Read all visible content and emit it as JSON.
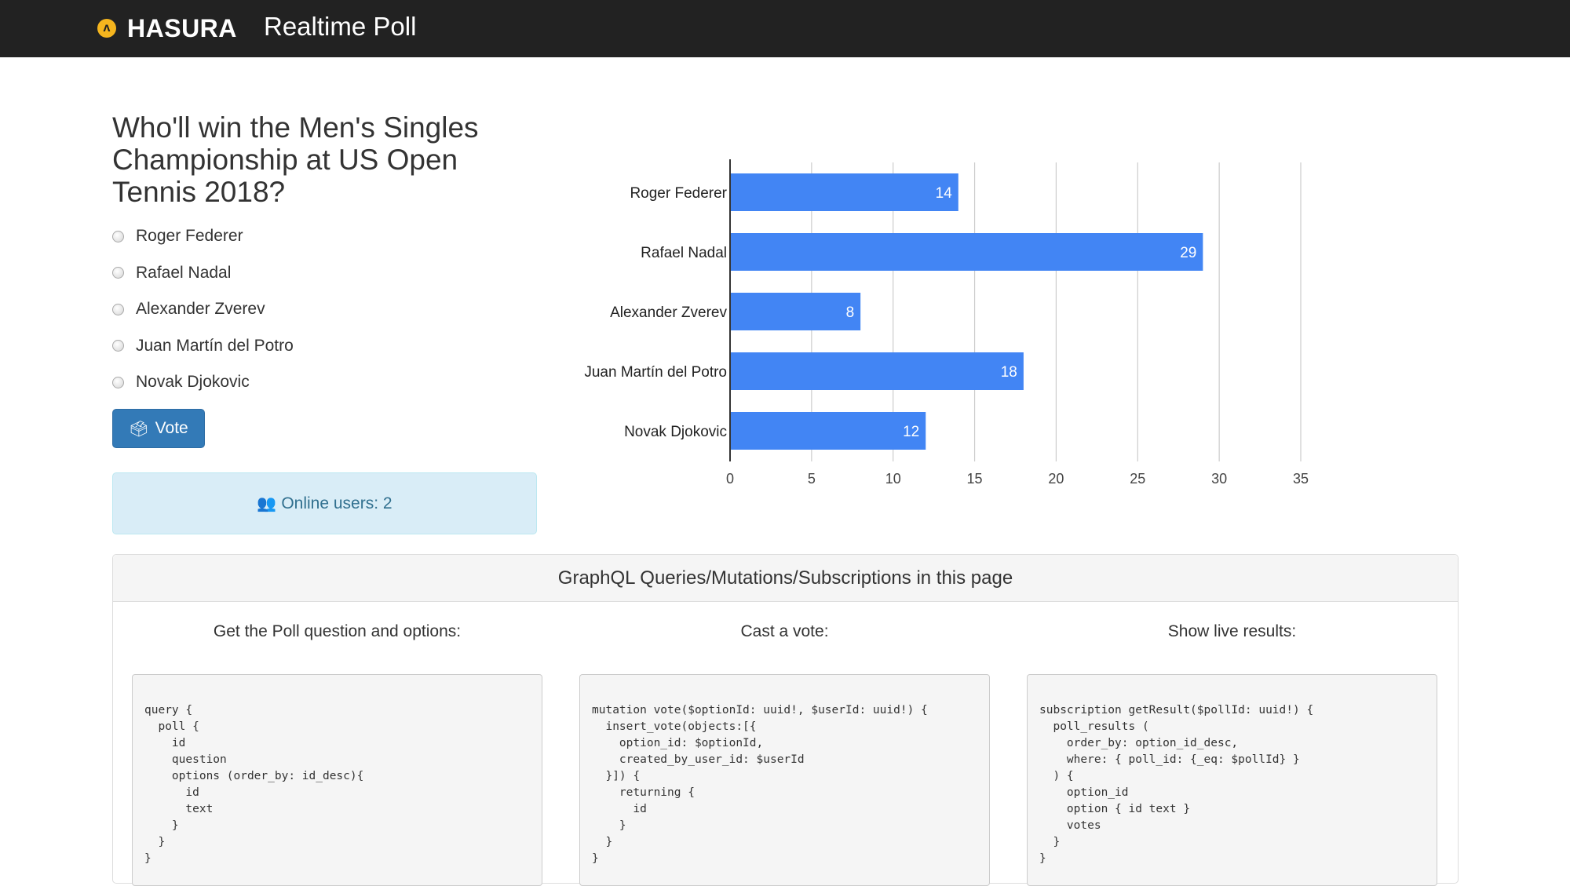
{
  "header": {
    "logo_text": "HASURA",
    "logo_mark": "ʌ",
    "app_title": "Realtime Poll"
  },
  "poll": {
    "question": "Who'll win the Men's Singles Championship at US Open Tennis 2018?",
    "options": [
      {
        "label": "Roger Federer"
      },
      {
        "label": "Rafael Nadal"
      },
      {
        "label": "Alexander Zverev"
      },
      {
        "label": "Juan Martín del Potro"
      },
      {
        "label": "Novak Djokovic"
      }
    ],
    "vote_button": {
      "icon": "ballot-box-icon",
      "label": "Vote"
    },
    "online_users": {
      "icon": "users-icon",
      "text": "Online users: 2"
    }
  },
  "chart_data": {
    "type": "bar",
    "orientation": "horizontal",
    "categories": [
      "Roger Federer",
      "Rafael Nadal",
      "Alexander Zverev",
      "Juan Martín del Potro",
      "Novak Djokovic"
    ],
    "values": [
      14,
      29,
      8,
      18,
      12
    ],
    "xlim": [
      0,
      35
    ],
    "xticks": [
      0,
      5,
      10,
      15,
      20,
      25,
      30,
      35
    ],
    "grid": true,
    "bar_color": "#4285f4",
    "data_labels": true
  },
  "graphql_panel": {
    "heading": "GraphQL Queries/Mutations/Subscriptions in this page",
    "columns": [
      {
        "title": "Get the Poll question and options:",
        "code": "query {\n  poll {\n    id\n    question\n    options (order_by: id_desc){\n      id\n      text\n    }\n  }\n}"
      },
      {
        "title": "Cast a vote:",
        "code": "mutation vote($optionId: uuid!, $userId: uuid!) {\n  insert_vote(objects:[{\n    option_id: $optionId,\n    created_by_user_id: $userId\n  }]) {\n    returning {\n      id\n    }\n  }\n}"
      },
      {
        "title": "Show live results:",
        "code": "subscription getResult($pollId: uuid!) {\n  poll_results (\n    order_by: option_id_desc,\n    where: { poll_id: {_eq: $pollId} }\n  ) {\n    option_id\n    option { id text }\n    votes\n  }\n}"
      }
    ]
  },
  "colors": {
    "navbar": "#222222",
    "primary_button": "#337ab7",
    "info_background": "#d9edf7",
    "info_text": "#31708f",
    "bar": "#4285f4"
  }
}
